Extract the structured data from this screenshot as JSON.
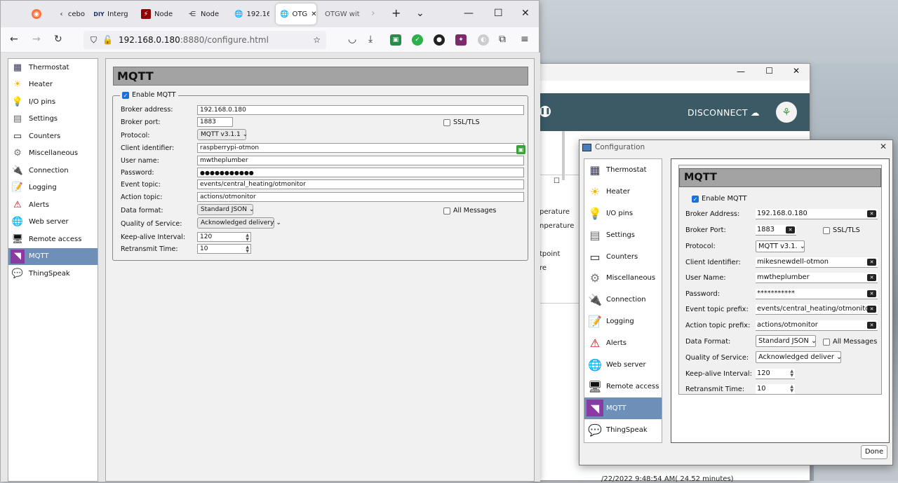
{
  "browser": {
    "tabs": [
      {
        "label": "",
        "icon": "firefox-icon"
      },
      {
        "label": "cebo",
        "icon": "back-icon"
      },
      {
        "label": "Interg",
        "icon": "diy-icon"
      },
      {
        "label": "Node",
        "icon": "node-icon"
      },
      {
        "label": "Node",
        "icon": "node-share-icon"
      },
      {
        "label": "192.16",
        "icon": "globe-icon"
      },
      {
        "label": "OTG",
        "icon": "globe-icon",
        "active": true
      },
      {
        "label": "OTGW wit",
        "icon": ""
      }
    ],
    "new_tab": "+",
    "url_host": "192.168.0.180",
    "url_rest": ":8880/configure.html"
  },
  "sidebar": {
    "items": [
      {
        "label": "Thermostat",
        "icon": "thermostat-icon",
        "glyph": "▦"
      },
      {
        "label": "Heater",
        "icon": "sun-icon",
        "glyph": "☀"
      },
      {
        "label": "I/O pins",
        "icon": "bulb-icon",
        "glyph": "💡"
      },
      {
        "label": "Settings",
        "icon": "settings-icon",
        "glyph": "▤"
      },
      {
        "label": "Counters",
        "icon": "counter-icon",
        "glyph": "▭"
      },
      {
        "label": "Miscellaneous",
        "icon": "gear-icon",
        "glyph": "⚙"
      },
      {
        "label": "Connection",
        "icon": "plug-icon",
        "glyph": "🔌"
      },
      {
        "label": "Logging",
        "icon": "notepad-icon",
        "glyph": "📝"
      },
      {
        "label": "Alerts",
        "icon": "alert-icon",
        "glyph": "⚠"
      },
      {
        "label": "Web server",
        "icon": "globe-icon",
        "glyph": "🌐"
      },
      {
        "label": "Remote access",
        "icon": "computer-icon",
        "glyph": "🖥"
      },
      {
        "label": "MQTT",
        "icon": "mqtt-icon",
        "glyph": "◥",
        "selected": true
      },
      {
        "label": "ThingSpeak",
        "icon": "chat-icon",
        "glyph": "💬"
      }
    ]
  },
  "form": {
    "title": "MQTT",
    "enable_label": "Enable MQTT",
    "broker_address_label": "Broker address:",
    "broker_address": "192.168.0.180",
    "broker_port_label": "Broker port:",
    "broker_port": "1883",
    "ssl_label": "SSL/TLS",
    "protocol_label": "Protocol:",
    "protocol": "MQTT v3.1.1",
    "client_id_label": "Client identifier:",
    "client_id": "raspberrypi-otmon",
    "user_label": "User name:",
    "user": "mwtheplumber",
    "password_label": "Password:",
    "password": "●●●●●●●●●●●",
    "event_label": "Event topic:",
    "event": "events/central_heating/otmonitor",
    "action_label": "Action topic:",
    "action": "actions/otmonitor",
    "format_label": "Data format:",
    "format": "Standard JSON",
    "all_messages_label": "All Messages",
    "qos_label": "Quality of Service:",
    "qos": "Acknowledged delivery",
    "keepalive_label": "Keep-alive Interval:",
    "keepalive": "120",
    "retransmit_label": "Retransmit Time:",
    "retransmit": "10"
  },
  "mid": {
    "disconnect": "DISCONNECT",
    "lines": [
      "perature",
      "nperature",
      "tpoint",
      "re"
    ],
    "bottom": "/22/2022 9:48:54 AM( 24.52 minutes)"
  },
  "dialog": {
    "title": "Configuration",
    "items": [
      {
        "label": "Thermostat",
        "glyph": "▦",
        "icon": "thermostat-icon"
      },
      {
        "label": "Heater",
        "glyph": "☀",
        "icon": "sun-icon"
      },
      {
        "label": "I/O pins",
        "glyph": "💡",
        "icon": "bulb-icon"
      },
      {
        "label": "Settings",
        "glyph": "▤",
        "icon": "settings-icon"
      },
      {
        "label": "Counters",
        "glyph": "▭",
        "icon": "counter-icon"
      },
      {
        "label": "Miscellaneous",
        "glyph": "⚙",
        "icon": "gear-icon"
      },
      {
        "label": "Connection",
        "glyph": "🔌",
        "icon": "plug-icon"
      },
      {
        "label": "Logging",
        "glyph": "📝",
        "icon": "notepad-icon"
      },
      {
        "label": "Alerts",
        "glyph": "⚠",
        "icon": "alert-icon"
      },
      {
        "label": "Web server",
        "glyph": "🌐",
        "icon": "globe-icon"
      },
      {
        "label": "Remote access",
        "glyph": "🖥",
        "icon": "computer-icon"
      },
      {
        "label": "MQTT",
        "glyph": "◥",
        "icon": "mqtt-icon",
        "selected": true
      },
      {
        "label": "ThingSpeak",
        "glyph": "💬",
        "icon": "chat-icon"
      }
    ],
    "title_mqtt": "MQTT",
    "enable_label": "Enable MQTT",
    "broker_address_label": "Broker Address:",
    "broker_address": "192.168.0.180",
    "broker_port_label": "Broker Port:",
    "broker_port": "1883",
    "ssl_label": "SSL/TLS",
    "protocol_label": "Protocol:",
    "protocol": "MQTT v3.1.",
    "client_id_label": "Client Identifier:",
    "client_id": "mikesnewdell-otmon",
    "user_label": "User Name:",
    "user": "mwtheplumber",
    "password_label": "Password:",
    "password": "***********",
    "event_label": "Event topic prefix:",
    "event": "events/central_heating/otmonitor",
    "action_label": "Action topic prefix:",
    "action": "actions/otmonitor",
    "format_label": "Data Format:",
    "format": "Standard JSON",
    "all_messages_label": "All Messages",
    "qos_label": "Quality of Service:",
    "qos": "Acknowledged deliver",
    "keepalive_label": "Keep-alive Interval:",
    "keepalive": "120",
    "retransmit_label": "Retransmit Time:",
    "retransmit": "10",
    "done": "Done"
  }
}
